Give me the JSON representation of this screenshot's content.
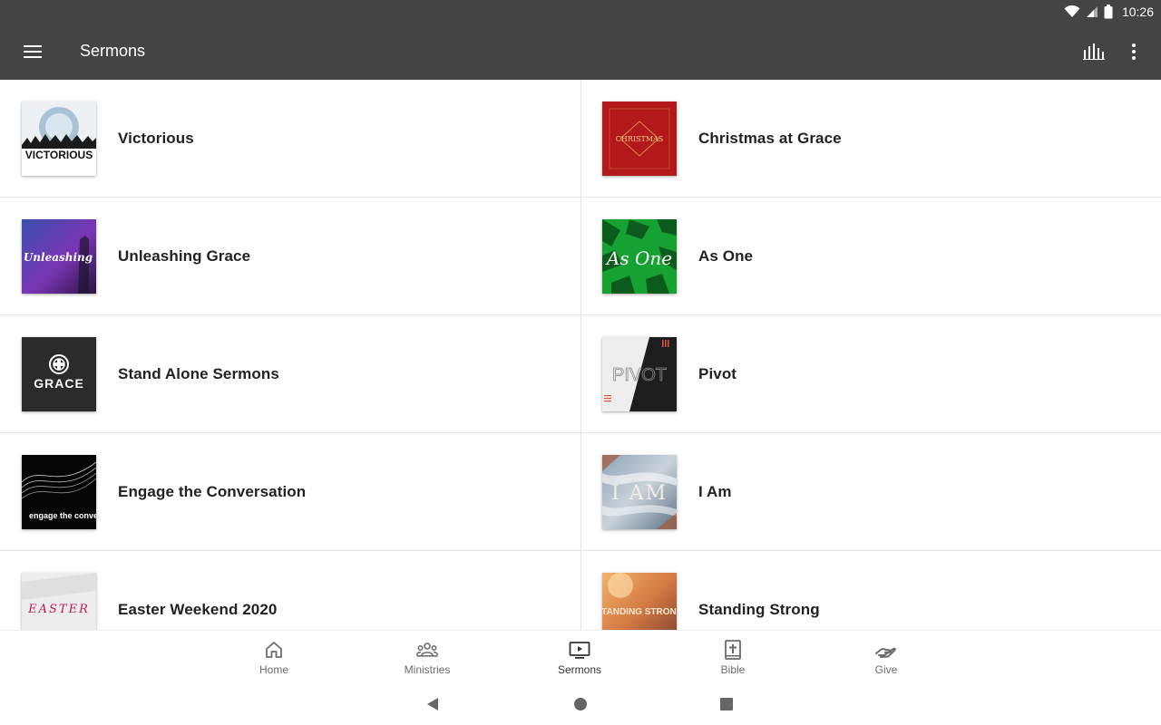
{
  "status_bar": {
    "time": "10:26"
  },
  "app_bar": {
    "title": "Sermons",
    "menu_icon": "hamburger-menu-icon",
    "actions": [
      "audio-bars-icon",
      "more-vert-icon"
    ]
  },
  "sermons": {
    "left": [
      {
        "title": "Victorious",
        "art_text": "VICTORIOUS"
      },
      {
        "title": "Unleashing Grace",
        "art_text": "Unleashing"
      },
      {
        "title": "Stand Alone Sermons",
        "art_text": "GRACE"
      },
      {
        "title": "Engage the Conversation",
        "art_text": "engage the conversation"
      },
      {
        "title": "Easter Weekend 2020",
        "art_text": "EASTER"
      }
    ],
    "right": [
      {
        "title": "Christmas at Grace",
        "art_text": "CHRISTMAS"
      },
      {
        "title": "As One",
        "art_text": "As One"
      },
      {
        "title": "Pivot",
        "art_text": "PIVOT"
      },
      {
        "title": "I Am",
        "art_text": "I AM"
      },
      {
        "title": "Standing Strong",
        "art_text": "STANDING STRONG"
      }
    ]
  },
  "bottom_nav": {
    "items": [
      {
        "label": "Home",
        "icon": "home-icon"
      },
      {
        "label": "Ministries",
        "icon": "people-group-icon"
      },
      {
        "label": "Sermons",
        "icon": "tv-play-icon",
        "active": true
      },
      {
        "label": "Bible",
        "icon": "bible-book-icon"
      },
      {
        "label": "Give",
        "icon": "giving-hand-icon"
      }
    ]
  },
  "colors": {
    "app_bar": "#444444",
    "divider": "#e4e4e4",
    "nav_label": "#6b6b6b",
    "nav_label_active": "#333333",
    "title_text": "#222222"
  }
}
